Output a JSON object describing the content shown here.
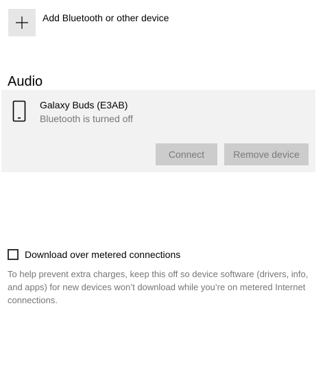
{
  "add_device": {
    "icon": "plus-icon",
    "label": "Add Bluetooth or other device"
  },
  "audio_section": {
    "heading": "Audio",
    "device": {
      "icon": "phone-icon",
      "name": "Galaxy Buds (E3AB)",
      "status": "Bluetooth is turned off",
      "connect_label": "Connect",
      "remove_label": "Remove device"
    }
  },
  "metered": {
    "checked": false,
    "label": "Download over metered connections",
    "help": "To help prevent extra charges, keep this off so device software (drivers, info, and apps) for new devices won’t download while you’re on metered Internet connections."
  },
  "colors": {
    "card_background": "#f2f2f2",
    "button_disabled_background": "#cccccc",
    "button_disabled_text": "#7a7a7a",
    "secondary_text": "#767676"
  }
}
